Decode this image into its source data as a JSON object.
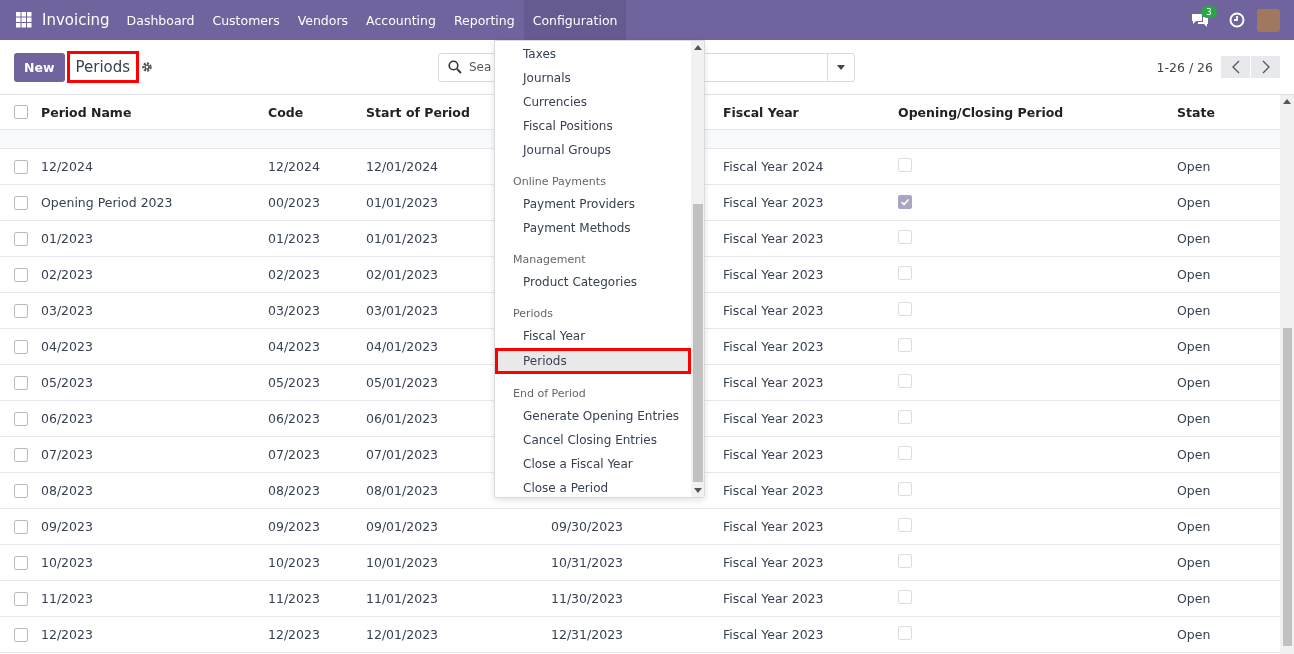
{
  "navbar": {
    "app_name": "Invoicing",
    "menu": [
      {
        "label": "Dashboard",
        "selected": false
      },
      {
        "label": "Customers",
        "selected": false
      },
      {
        "label": "Vendors",
        "selected": false
      },
      {
        "label": "Accounting",
        "selected": false
      },
      {
        "label": "Reporting",
        "selected": false
      },
      {
        "label": "Configuration",
        "selected": true
      }
    ],
    "message_count": "3"
  },
  "control_panel": {
    "new_button": "New",
    "breadcrumb": {
      "label": "Periods",
      "highlighted": true
    },
    "search": {
      "placeholder": "Sea"
    },
    "pager": "1-26 / 26"
  },
  "table": {
    "all_selected": false,
    "columns": [
      "Period Name",
      "Code",
      "Start of Period",
      "Fiscal Year",
      "Opening/Closing Period",
      "State"
    ],
    "rows": [
      {
        "selected": false,
        "name": "12/2024",
        "code": "12/2024",
        "start": "12/01/2024",
        "fiscal_year": "Fiscal Year 2024",
        "opening": false,
        "state": "Open"
      },
      {
        "selected": false,
        "name": "Opening Period 2023",
        "code": "00/2023",
        "start": "01/01/2023",
        "fiscal_year": "Fiscal Year 2023",
        "opening": true,
        "state": "Open"
      },
      {
        "selected": false,
        "name": "01/2023",
        "code": "01/2023",
        "start": "01/01/2023",
        "fiscal_year": "Fiscal Year 2023",
        "opening": false,
        "state": "Open"
      },
      {
        "selected": false,
        "name": "02/2023",
        "code": "02/2023",
        "start": "02/01/2023",
        "fiscal_year": "Fiscal Year 2023",
        "opening": false,
        "state": "Open"
      },
      {
        "selected": false,
        "name": "03/2023",
        "code": "03/2023",
        "start": "03/01/2023",
        "fiscal_year": "Fiscal Year 2023",
        "opening": false,
        "state": "Open"
      },
      {
        "selected": false,
        "name": "04/2023",
        "code": "04/2023",
        "start": "04/01/2023",
        "fiscal_year": "Fiscal Year 2023",
        "opening": false,
        "state": "Open"
      },
      {
        "selected": false,
        "name": "05/2023",
        "code": "05/2023",
        "start": "05/01/2023",
        "fiscal_year": "Fiscal Year 2023",
        "opening": false,
        "state": "Open"
      },
      {
        "selected": false,
        "name": "06/2023",
        "code": "06/2023",
        "start": "06/01/2023",
        "fiscal_year": "Fiscal Year 2023",
        "opening": false,
        "state": "Open"
      },
      {
        "selected": false,
        "name": "07/2023",
        "code": "07/2023",
        "start": "07/01/2023",
        "fiscal_year": "Fiscal Year 2023",
        "opening": false,
        "state": "Open"
      },
      {
        "selected": false,
        "name": "08/2023",
        "code": "08/2023",
        "start": "08/01/2023",
        "fiscal_year": "Fiscal Year 2023",
        "opening": false,
        "state": "Open"
      },
      {
        "selected": false,
        "name": "09/2023",
        "code": "09/2023",
        "start": "09/01/2023",
        "end": "09/30/2023",
        "fiscal_year": "Fiscal Year 2023",
        "opening": false,
        "state": "Open"
      },
      {
        "selected": false,
        "name": "10/2023",
        "code": "10/2023",
        "start": "10/01/2023",
        "end": "10/31/2023",
        "fiscal_year": "Fiscal Year 2023",
        "opening": false,
        "state": "Open"
      },
      {
        "selected": false,
        "name": "11/2023",
        "code": "11/2023",
        "start": "11/01/2023",
        "end": "11/30/2023",
        "fiscal_year": "Fiscal Year 2023",
        "opening": false,
        "state": "Open"
      },
      {
        "selected": false,
        "name": "12/2023",
        "code": "12/2023",
        "start": "12/01/2023",
        "end": "12/31/2023",
        "fiscal_year": "Fiscal Year 2023",
        "opening": false,
        "state": "Open"
      }
    ]
  },
  "config_menu": {
    "sections": [
      {
        "items": [
          {
            "label": "Taxes",
            "selected": false
          },
          {
            "label": "Journals",
            "selected": false
          },
          {
            "label": "Currencies",
            "selected": false
          },
          {
            "label": "Fiscal Positions",
            "selected": false
          },
          {
            "label": "Journal Groups",
            "selected": false
          }
        ]
      },
      {
        "header": "Online Payments",
        "items": [
          {
            "label": "Payment Providers",
            "selected": false
          },
          {
            "label": "Payment Methods",
            "selected": false
          }
        ]
      },
      {
        "header": "Management",
        "items": [
          {
            "label": "Product Categories",
            "selected": false
          }
        ]
      },
      {
        "header": "Periods",
        "items": [
          {
            "label": "Fiscal Year",
            "selected": false
          },
          {
            "label": "Periods",
            "selected": true
          }
        ]
      },
      {
        "header": "End of Period",
        "items": [
          {
            "label": "Generate Opening Entries",
            "selected": false
          },
          {
            "label": "Cancel Closing Entries",
            "selected": false
          },
          {
            "label": "Close a Fiscal Year",
            "selected": false
          },
          {
            "label": "Close a Period",
            "selected": false
          }
        ]
      }
    ]
  }
}
